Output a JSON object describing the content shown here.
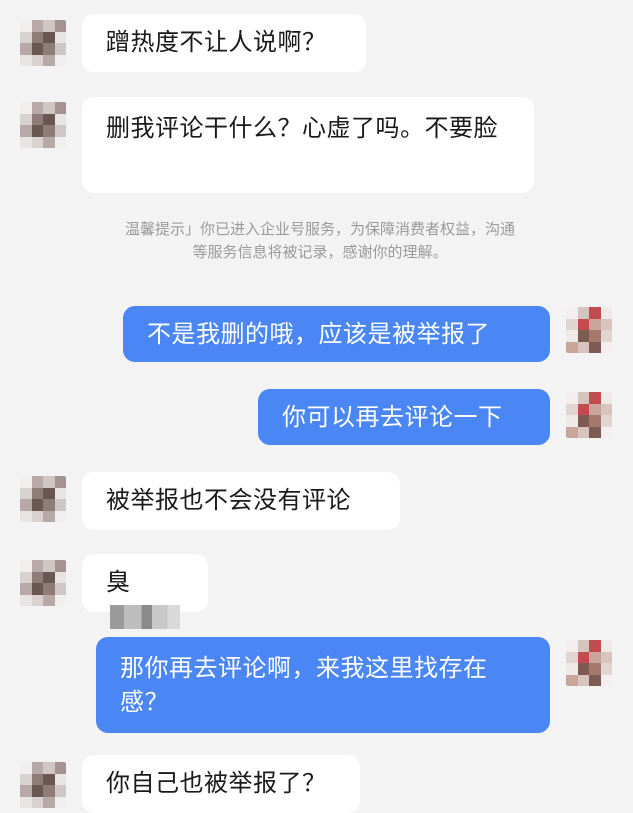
{
  "messages": [
    {
      "text": "蹭热度不让人说啊？"
    },
    {
      "text": "删我评论干什么？心虚了吗。不要脸"
    },
    {
      "text": "不是我删的哦，应该是被举报了"
    },
    {
      "text": "你可以再去评论一下"
    },
    {
      "text": "被举报也不会没有评论"
    },
    {
      "text": "臭"
    },
    {
      "text": "那你再去评论啊，来我这里找存在感？"
    },
    {
      "text": "你自己也被举报了？"
    }
  ],
  "system_notice": {
    "line1": "温馨提示」你已进入企业号服务，为保障消费者权益，沟通",
    "line2": "等服务信息将被记录，感谢你的理解。"
  },
  "colors": {
    "incoming_bubble": "#ffffff",
    "outgoing_bubble": "#4a86f4",
    "background": "#f3f3f3",
    "notice_text": "#9a9a9a"
  },
  "icons": {
    "contact_avatar": "pixelated-avatar",
    "self_avatar": "pixelated-avatar"
  }
}
